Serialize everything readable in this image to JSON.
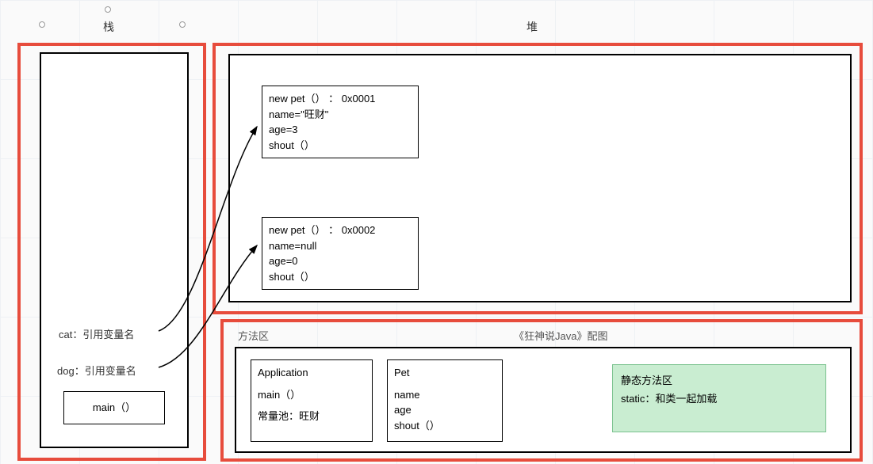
{
  "labels": {
    "stack": "栈",
    "heap": "堆"
  },
  "stack": {
    "cat": "cat：引用变量名",
    "dog": "dog：引用变量名",
    "main": "main（）"
  },
  "heap": {
    "obj1": {
      "line1": "new pet（） ： 0x0001",
      "line2": "name=\"旺财\"",
      "line3": "age=3",
      "line4": "shout（）"
    },
    "obj2": {
      "line1": "new pet（） ： 0x0002",
      "line2": "name=null",
      "line3": "age=0",
      "line4": "shout（）"
    }
  },
  "methodArea": {
    "title": "方法区",
    "subtitle": "《狂神说Java》配图",
    "application": {
      "title": "Application",
      "main": "main（）",
      "pool": "常量池：旺财"
    },
    "pet": {
      "title": "Pet",
      "f1": "name",
      "f2": "age",
      "f3": "shout（）"
    },
    "static": {
      "title": "静态方法区",
      "desc": "static：和类一起加载"
    }
  }
}
